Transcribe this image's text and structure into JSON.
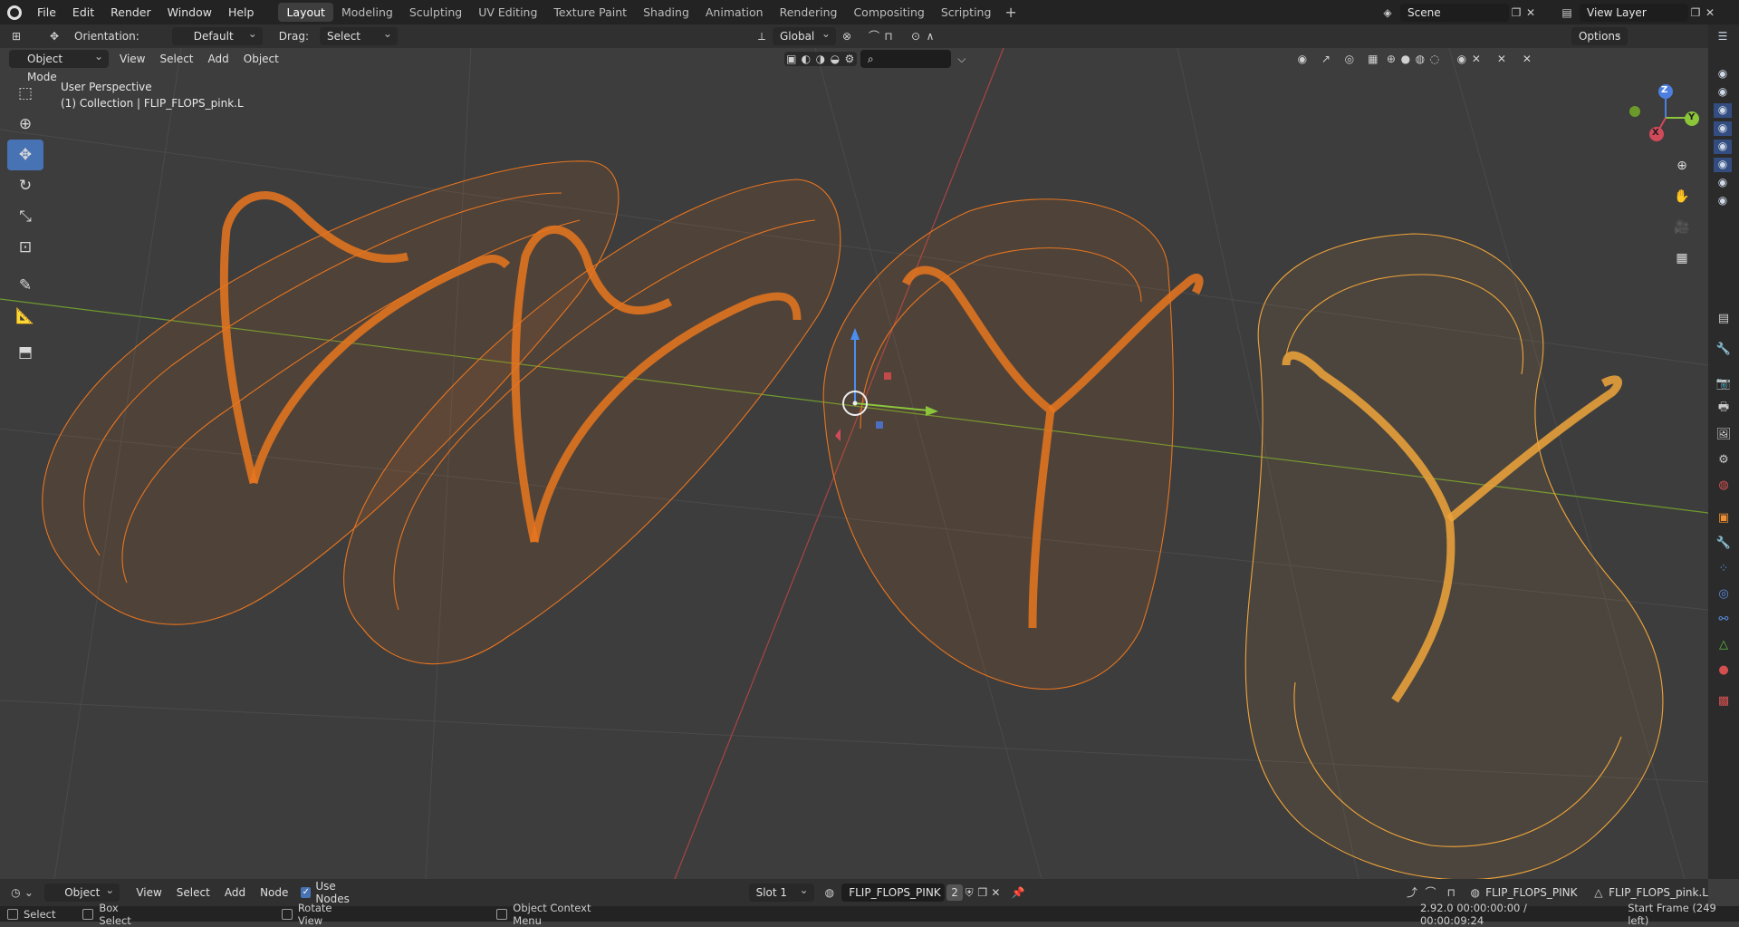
{
  "colors": {
    "accent": "#4772b3",
    "wire_selected": "#e8751f",
    "wire_active": "#f0a43a",
    "axis_x": "#c44a4a",
    "axis_y": "#7aa533"
  },
  "menu": {
    "items": [
      "File",
      "Edit",
      "Render",
      "Window",
      "Help"
    ]
  },
  "workspaces": {
    "tabs": [
      "Layout",
      "Modeling",
      "Sculpting",
      "UV Editing",
      "Texture Paint",
      "Shading",
      "Animation",
      "Rendering",
      "Compositing",
      "Scripting"
    ],
    "active": "Layout",
    "add": "+"
  },
  "scene": {
    "name": "Scene",
    "view_layer": "View Layer"
  },
  "tool_header": {
    "orientation_label": "Orientation:",
    "orientation_value": "Default",
    "drag_label": "Drag:",
    "drag_value": "Select Box",
    "transform_orientation": "Global",
    "options": "Options"
  },
  "viewport_header": {
    "mode": "Object Mode",
    "menus": [
      "View",
      "Select",
      "Add",
      "Object"
    ]
  },
  "viewport": {
    "perspective": "User Perspective",
    "collection_info": "(1) Collection | FLIP_FLOPS_pink.L"
  },
  "gizmo": {
    "x": "X",
    "y": "Y",
    "z": "Z"
  },
  "toolbar": {
    "tools": [
      "select-box",
      "cursor",
      "move",
      "rotate",
      "scale",
      "transform",
      "annotate",
      "measure",
      "add-cube"
    ],
    "active": "move"
  },
  "node_header": {
    "editor": "Object",
    "menus": [
      "View",
      "Select",
      "Add",
      "Node"
    ],
    "use_nodes": "Use Nodes",
    "slot": "Slot 1",
    "material": "FLIP_FLOPS_PINK",
    "users": "2",
    "material_right": "FLIP_FLOPS_PINK",
    "object_right": "FLIP_FLOPS_pink.L"
  },
  "status": {
    "select": "Select",
    "box_select": "Box Select",
    "rotate_view": "Rotate View",
    "context_menu": "Object Context Menu",
    "version_time": "2.92.0  00:00:00:00 / 00:00:09:24",
    "start_frame": "Start Frame (249 left)"
  }
}
